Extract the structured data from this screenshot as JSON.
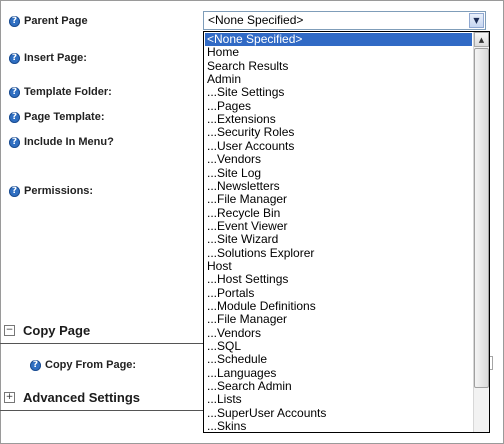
{
  "fields": {
    "parent_page": "Parent Page",
    "insert_page": "Insert Page:",
    "template_folder": "Template Folder:",
    "page_template": "Page Template:",
    "include_in_menu": "Include In Menu?",
    "permissions": "Permissions:",
    "copy_from_page": "Copy From Page:"
  },
  "sections": {
    "copy_page": {
      "label": "Copy Page",
      "toggle": "−"
    },
    "advanced_settings": {
      "label": "Advanced Settings",
      "toggle": "+"
    }
  },
  "icons": {
    "help": "?",
    "dropdown_arrow": "▼",
    "scroll_up": "▲"
  },
  "select": {
    "value": "<None Specified>",
    "options": [
      "<None Specified>",
      "Home",
      "Search Results",
      "Admin",
      "...Site Settings",
      "...Pages",
      "...Extensions",
      "...Security Roles",
      "...User Accounts",
      "...Vendors",
      "...Site Log",
      "...Newsletters",
      "...File Manager",
      "...Recycle Bin",
      "...Event Viewer",
      "...Site Wizard",
      "...Solutions Explorer",
      "Host",
      "...Host Settings",
      "...Portals",
      "...Module Definitions",
      "...File Manager",
      "...Vendors",
      "...SQL",
      "...Schedule",
      "...Languages",
      "...Search Admin",
      "...Lists",
      "...SuperUser Accounts",
      "...Skins"
    ],
    "selected_index": 0
  },
  "colors": {
    "selection": "#316ac5",
    "help_icon": "#2f6fc2"
  }
}
